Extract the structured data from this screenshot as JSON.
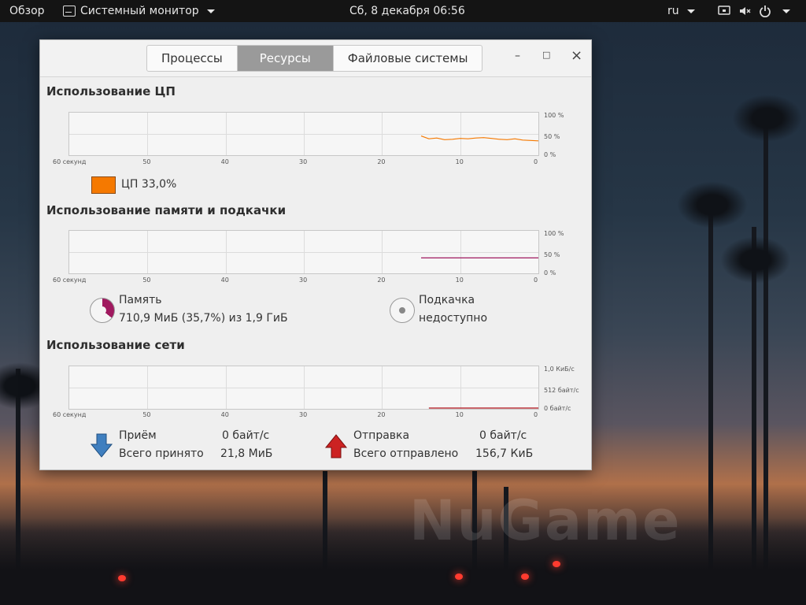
{
  "topbar": {
    "overview": "Обзор",
    "app_menu": "Системный монитор",
    "clock": "Сб, 8 декабря  06:56",
    "language": "ru"
  },
  "window": {
    "tabs": [
      {
        "label": "Процессы",
        "active": false
      },
      {
        "label": "Ресурсы",
        "active": true
      },
      {
        "label": "Файловые системы",
        "active": false
      }
    ],
    "controls": {
      "minimize": "–",
      "maximize": "□",
      "close": "×"
    }
  },
  "cpu": {
    "title": "Использование ЦП",
    "legend_label": "ЦП 33,0%",
    "color": "#f57900",
    "y_ticks": [
      "100 %",
      "50 %",
      "0 %"
    ]
  },
  "memory": {
    "title": "Использование памяти и подкачки",
    "y_ticks": [
      "100 %",
      "50 %",
      "0 %"
    ],
    "mem_label": "Память",
    "mem_value": "710,9 МиБ (35,7%) из 1,9 ГиБ",
    "mem_color": "#a0195f",
    "swap_label": "Подкачка",
    "swap_value": "недоступно"
  },
  "network": {
    "title": "Использование сети",
    "y_ticks": [
      "1,0 КиБ/с",
      "512 байт/с",
      "0 байт/с"
    ],
    "rx_label": "Приём",
    "rx_rate": "0 байт/с",
    "rx_total_label": "Всего принято",
    "rx_total": "21,8 МиБ",
    "tx_label": "Отправка",
    "tx_rate": "0 байт/с",
    "tx_total_label": "Всего отправлено",
    "tx_total": "156,7 КиБ",
    "rx_color": "#3f7fbf",
    "tx_color": "#cc2222"
  },
  "x_ticks": [
    "60 секунд",
    "50",
    "40",
    "30",
    "20",
    "10",
    "0"
  ],
  "chart_data": [
    {
      "type": "line",
      "title": "Использование ЦП",
      "x": [
        15,
        14,
        13,
        12,
        11,
        10,
        9,
        8,
        7,
        6,
        5,
        4,
        3,
        2,
        1,
        0
      ],
      "series": [
        {
          "name": "ЦП",
          "values": [
            45,
            38,
            40,
            36,
            37,
            39,
            38,
            40,
            41,
            39,
            37,
            36,
            38,
            35,
            34,
            33
          ]
        }
      ],
      "ylim": [
        0,
        100
      ],
      "xlim": [
        60,
        0
      ]
    },
    {
      "type": "line",
      "title": "Использование памяти и подкачки",
      "x": [
        15,
        0
      ],
      "series": [
        {
          "name": "Память",
          "values": [
            35.7,
            35.7
          ]
        }
      ],
      "ylim": [
        0,
        100
      ],
      "xlim": [
        60,
        0
      ]
    },
    {
      "type": "line",
      "title": "Использование сети",
      "x": [
        14,
        0
      ],
      "series": [
        {
          "name": "Приём",
          "values": [
            0,
            0
          ]
        },
        {
          "name": "Отправка",
          "values": [
            0,
            0
          ]
        }
      ],
      "ylim": [
        0,
        1024
      ],
      "xlim": [
        60,
        0
      ]
    }
  ]
}
